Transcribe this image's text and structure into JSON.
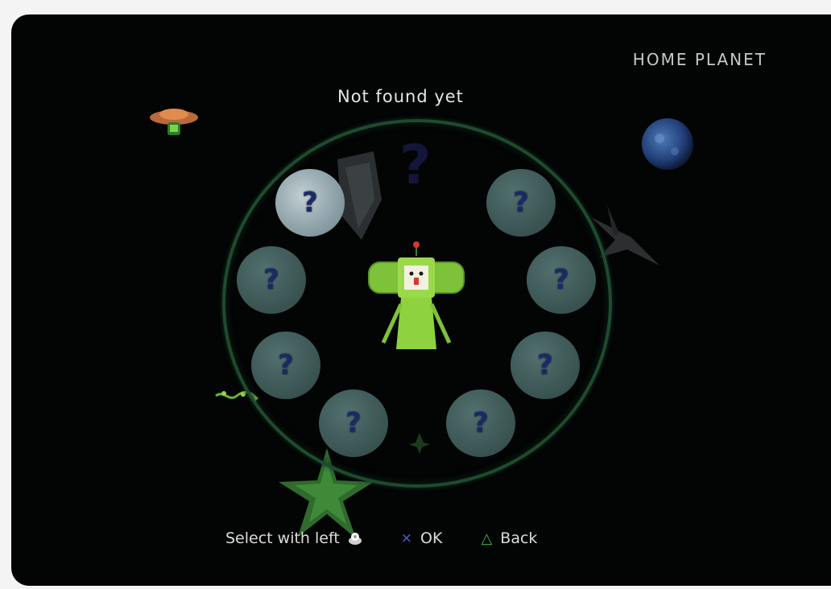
{
  "screen": {
    "title": "HOME PLANET",
    "status_text": "Not found yet"
  },
  "slots": [
    {
      "label": "?",
      "state": "selected"
    },
    {
      "label": "?",
      "state": "locked"
    },
    {
      "label": "?",
      "state": "locked"
    },
    {
      "label": "?",
      "state": "locked"
    },
    {
      "label": "?",
      "state": "locked"
    },
    {
      "label": "?",
      "state": "locked"
    },
    {
      "label": "?",
      "state": "locked"
    },
    {
      "label": "?",
      "state": "locked"
    }
  ],
  "center_mark": "?",
  "hud": {
    "select_label": "Select with left",
    "select_icon": "left-stick-icon",
    "ok_button": "×",
    "ok_label": "OK",
    "back_button": "△",
    "back_label": "Back"
  },
  "colors": {
    "background": "#030404",
    "ring": "#1f4a2f",
    "ok_button": "#4b68d2",
    "back_button": "#39b65a",
    "character": "#8ed33f"
  }
}
